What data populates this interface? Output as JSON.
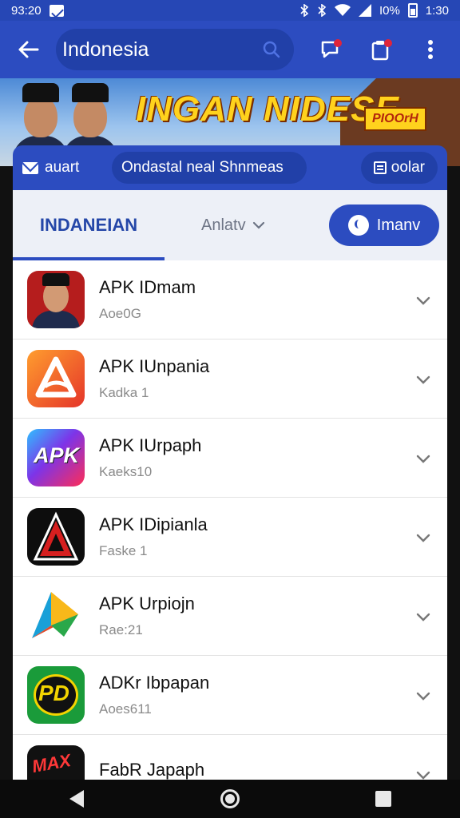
{
  "status_bar": {
    "time_left": "93:20",
    "battery_text": "I0%",
    "time_right": "1:30"
  },
  "app_bar": {
    "search_value": "Indonesia"
  },
  "banner": {
    "title": "INGAN NIDESE",
    "tag": "PIOOrH"
  },
  "sheet": {
    "mail_label": "auart",
    "hint": "Ondastal neal Shnmeas",
    "toolbar_label": "oolar"
  },
  "tabs": {
    "active": "INDANEIAN",
    "dropdown": "Anlatv",
    "join_label": "Imanv"
  },
  "apps": [
    {
      "title": "APK IDmam",
      "subtitle": "Aoe0G",
      "icon": "portrait-icon"
    },
    {
      "title": "APK IUnpania",
      "subtitle": "Kadka 1",
      "icon": "triangle-logo-icon"
    },
    {
      "title": "APK IUrpaph",
      "subtitle": "Kaeks10",
      "icon": "apk-logo-icon"
    },
    {
      "title": "APK IDipianla",
      "subtitle": "Faske 1",
      "icon": "red-a-logo-icon"
    },
    {
      "title": "APK Urpiojn",
      "subtitle": "Rae:21",
      "icon": "colorful-triangle-icon"
    },
    {
      "title": "ADKr Ibpapan",
      "subtitle": "Aoes611",
      "icon": "pd-logo-icon"
    },
    {
      "title": "FabR Japaph",
      "subtitle": "",
      "icon": "game-logo-icon"
    }
  ],
  "colors": {
    "primary": "#2c4cc0",
    "primary_dark": "#2140a8",
    "accent_yellow": "#ffd21d"
  },
  "icons": [
    "arrow-left-icon",
    "search-icon",
    "chat-alert-icon",
    "clipboard-alert-icon",
    "more-vert-icon",
    "chevron-down-icon"
  ]
}
